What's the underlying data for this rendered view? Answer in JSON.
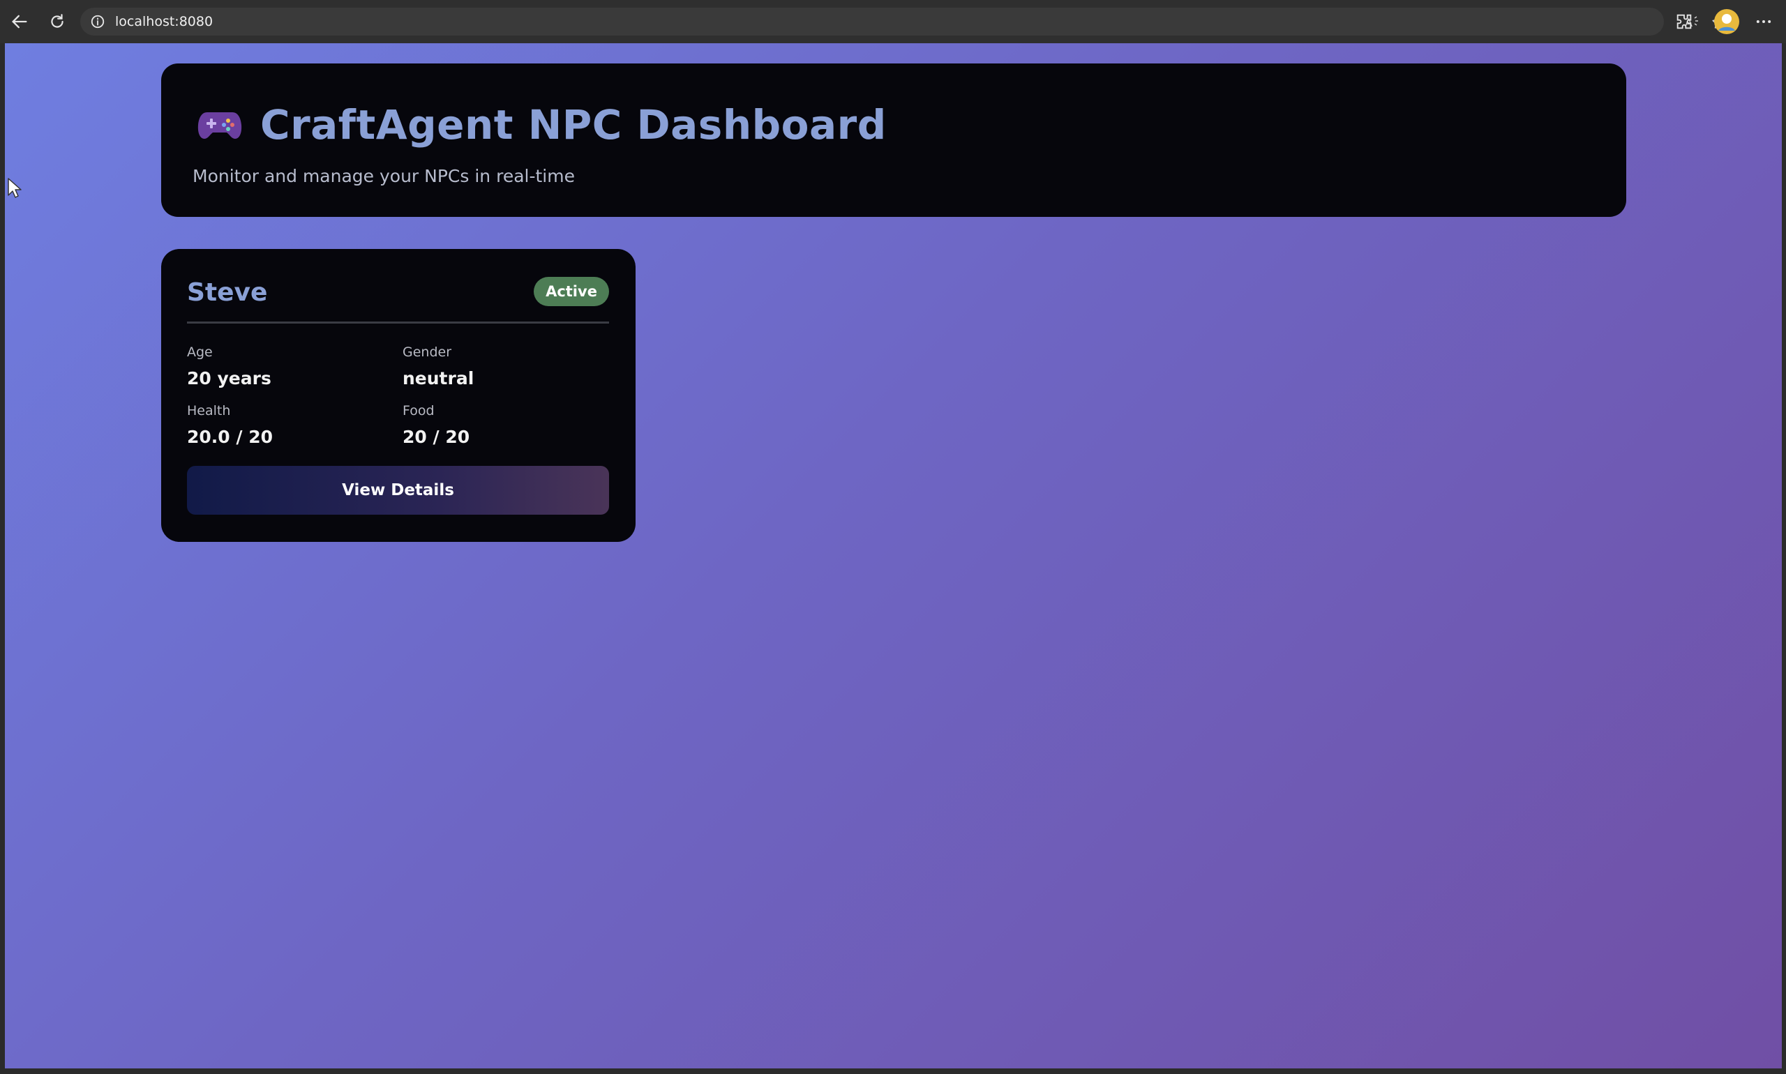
{
  "browser": {
    "url": "localhost:8080"
  },
  "header": {
    "title": "CraftAgent NPC Dashboard",
    "subtitle": "Monitor and manage your NPCs in real-time",
    "icon": "gamepad-icon"
  },
  "npcs": [
    {
      "name": "Steve",
      "status": "Active",
      "stats": {
        "age": {
          "label": "Age",
          "value": "20 years"
        },
        "gender": {
          "label": "Gender",
          "value": "neutral"
        },
        "health": {
          "label": "Health",
          "value": "20.0 / 20"
        },
        "food": {
          "label": "Food",
          "value": "20 / 20"
        }
      },
      "action_label": "View Details"
    }
  ],
  "colors": {
    "title": "#8aa0d6",
    "status_active": "#4d7d55",
    "card_bg": "#06060c"
  }
}
